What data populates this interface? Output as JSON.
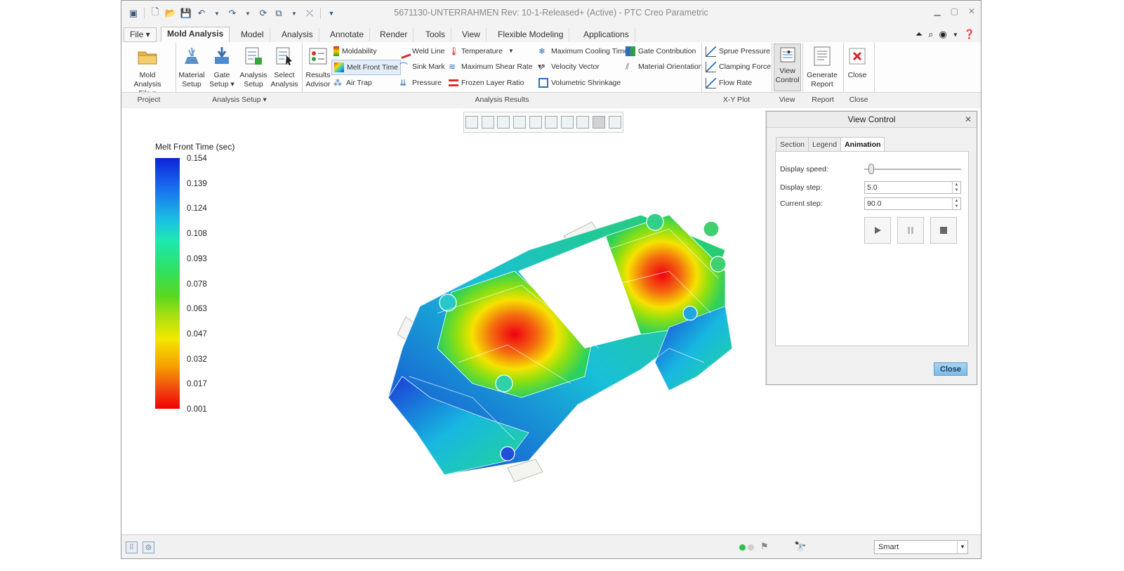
{
  "window": {
    "title": "5671130-UNTERRAHMEN Rev: 10-1-Released+ (Active) - PTC Creo Parametric"
  },
  "tabs": [
    "File",
    "Mold Analysis",
    "Model",
    "Analysis",
    "Annotate",
    "Render",
    "Tools",
    "View",
    "Flexible Modeling",
    "Applications"
  ],
  "ribbon": {
    "project": {
      "mold_analysis_file_1": "Mold Analysis",
      "mold_analysis_file_2": "File"
    },
    "analysis_setup": {
      "material_setup_1": "Material",
      "material_setup_2": "Setup",
      "gate_setup_1": "Gate",
      "gate_setup_2": "Setup",
      "analysis_setup_1": "Analysis",
      "analysis_setup_2": "Setup",
      "select_analysis_1": "Select",
      "select_analysis_2": "Analysis"
    },
    "analysis_results": {
      "results_advisor_1": "Results",
      "results_advisor_2": "Advisor",
      "moldability": "Moldability",
      "melt_front_time": "Melt Front Time",
      "air_trap": "Air Trap",
      "weld_line": "Weld Line",
      "sink_mark": "Sink Mark",
      "pressure": "Pressure",
      "temperature": "Temperature",
      "max_shear_rate": "Maximum Shear Rate",
      "frozen_layer_ratio": "Frozen Layer Ratio",
      "max_cooling_time": "Maximum Cooling Time",
      "velocity_vector": "Velocity Vector",
      "volumetric_shrinkage": "Volumetric Shrinkage",
      "gate_contribution": "Gate Contribution",
      "material_orientation": "Material Orientation"
    },
    "xy_plot": {
      "sprue_pressure": "Sprue Pressure",
      "clamping_force": "Clamping Force",
      "flow_rate": "Flow Rate"
    },
    "view": {
      "view_control_1": "View",
      "view_control_2": "Control"
    },
    "report": {
      "generate_report_1": "Generate",
      "generate_report_2": "Report"
    },
    "close": {
      "close": "Close"
    },
    "group_labels": {
      "project": "Project",
      "analysis_setup": "Analysis Setup",
      "analysis_results": "Analysis Results",
      "xy_plot": "X-Y Plot",
      "view": "View",
      "report": "Report",
      "close": "Close"
    }
  },
  "legend": {
    "title": "Melt Front Time (sec)",
    "ticks": [
      "0.154",
      "0.139",
      "0.124",
      "0.108",
      "0.093",
      "0.078",
      "0.063",
      "0.047",
      "0.032",
      "0.017",
      "0.001"
    ]
  },
  "view_control": {
    "title": "View Control",
    "tabs": [
      "Section",
      "Legend",
      "Animation"
    ],
    "active_tab": "Animation",
    "display_speed_label": "Display speed:",
    "display_step_label": "Display step:",
    "display_step_value": "5.0",
    "current_step_label": "Current step:",
    "current_step_value": "90.0",
    "close_label": "Close"
  },
  "statusbar": {
    "selection_filter": "Smart"
  },
  "colors": {
    "accent": "#7cbbe8",
    "close_red": "#d9202a"
  }
}
